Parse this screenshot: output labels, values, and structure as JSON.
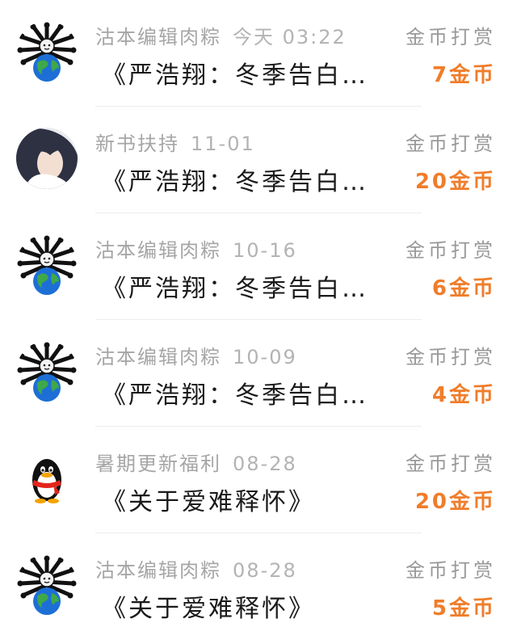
{
  "accent_color": "#f07d2a",
  "items": [
    {
      "avatar": "globe-cat-avatar",
      "author": "沽本编辑肉粽",
      "time": "今天 03:22",
      "title": "《严浩翔：冬季告白…",
      "reward_label": "金币打赏",
      "reward_amount": "7金币"
    },
    {
      "avatar": "portrait-avatar",
      "author": "新书扶持",
      "time": "11-01",
      "title": "《严浩翔：冬季告白…",
      "reward_label": "金币打赏",
      "reward_amount": "20金币"
    },
    {
      "avatar": "globe-cat-avatar",
      "author": "沽本编辑肉粽",
      "time": "10-16",
      "title": "《严浩翔：冬季告白…",
      "reward_label": "金币打赏",
      "reward_amount": "6金币"
    },
    {
      "avatar": "globe-cat-avatar",
      "author": "沽本编辑肉粽",
      "time": "10-09",
      "title": "《严浩翔：冬季告白…",
      "reward_label": "金币打赏",
      "reward_amount": "4金币"
    },
    {
      "avatar": "penguin-avatar",
      "author": "暑期更新福利",
      "time": "08-28",
      "title": "《关于爱难释怀》",
      "reward_label": "金币打赏",
      "reward_amount": "20金币"
    },
    {
      "avatar": "globe-cat-avatar",
      "author": "沽本编辑肉粽",
      "time": "08-28",
      "title": "《关于爱难释怀》",
      "reward_label": "金币打赏",
      "reward_amount": "5金币"
    }
  ]
}
